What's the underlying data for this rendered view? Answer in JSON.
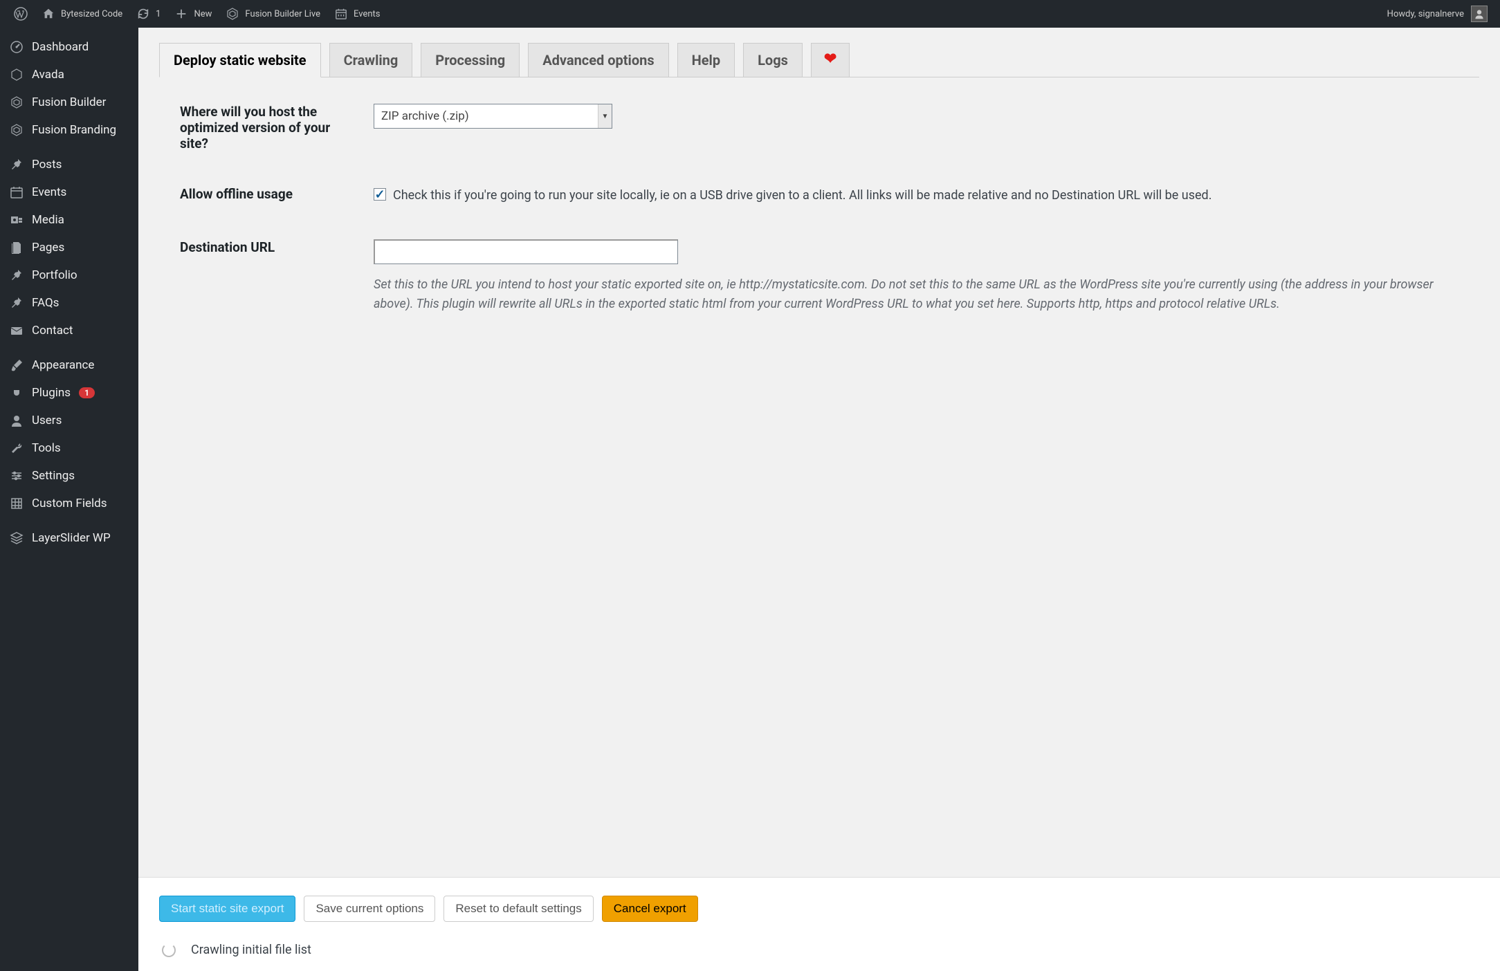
{
  "adminbar": {
    "site_name": "Bytesized Code",
    "update_count": "1",
    "new_label": "New",
    "fusion_builder": "Fusion Builder Live",
    "events": "Events",
    "howdy": "Howdy, signalnerve"
  },
  "sidebar": {
    "items": [
      {
        "icon": "dashboard",
        "label": "Dashboard"
      },
      {
        "icon": "avada",
        "label": "Avada"
      },
      {
        "icon": "fusion",
        "label": "Fusion Builder"
      },
      {
        "icon": "fusion",
        "label": "Fusion Branding"
      },
      {
        "sep": true
      },
      {
        "icon": "pin",
        "label": "Posts"
      },
      {
        "icon": "calendar",
        "label": "Events"
      },
      {
        "icon": "media",
        "label": "Media"
      },
      {
        "icon": "pages",
        "label": "Pages"
      },
      {
        "icon": "pin",
        "label": "Portfolio"
      },
      {
        "icon": "pin",
        "label": "FAQs"
      },
      {
        "icon": "mail",
        "label": "Contact"
      },
      {
        "sep": true
      },
      {
        "icon": "brush",
        "label": "Appearance"
      },
      {
        "icon": "plug",
        "label": "Plugins",
        "badge": "1"
      },
      {
        "icon": "user",
        "label": "Users"
      },
      {
        "icon": "wrench",
        "label": "Tools"
      },
      {
        "icon": "sliders",
        "label": "Settings"
      },
      {
        "icon": "grid",
        "label": "Custom Fields"
      },
      {
        "sep": true
      },
      {
        "icon": "layers",
        "label": "LayerSlider WP"
      }
    ]
  },
  "tabs": [
    {
      "label": "Deploy static website",
      "active": true
    },
    {
      "label": "Crawling"
    },
    {
      "label": "Processing"
    },
    {
      "label": "Advanced options"
    },
    {
      "label": "Help"
    },
    {
      "label": "Logs"
    },
    {
      "heart": true
    }
  ],
  "form": {
    "host_label": "Where will you host the optimized version of your site?",
    "host_value": "ZIP archive (.zip)",
    "offline_label": "Allow offline usage",
    "offline_help": "Check this if you're going to run your site locally, ie on a USB drive given to a client. All links will be made relative and no Destination URL will be used.",
    "offline_checked": true,
    "dest_label": "Destination URL",
    "dest_value": "",
    "dest_help": "Set this to the URL you intend to host your static exported site on, ie http://mystaticsite.com. Do not set this to the same URL as the WordPress site you're currently using (the address in your browser above). This plugin will rewrite all URLs in the exported static html from your current WordPress URL to what you set here. Supports http, https and protocol relative URLs."
  },
  "actions": {
    "start": "Start static site export",
    "save": "Save current options",
    "reset": "Reset to default settings",
    "cancel": "Cancel export",
    "status": "Crawling initial file list"
  }
}
